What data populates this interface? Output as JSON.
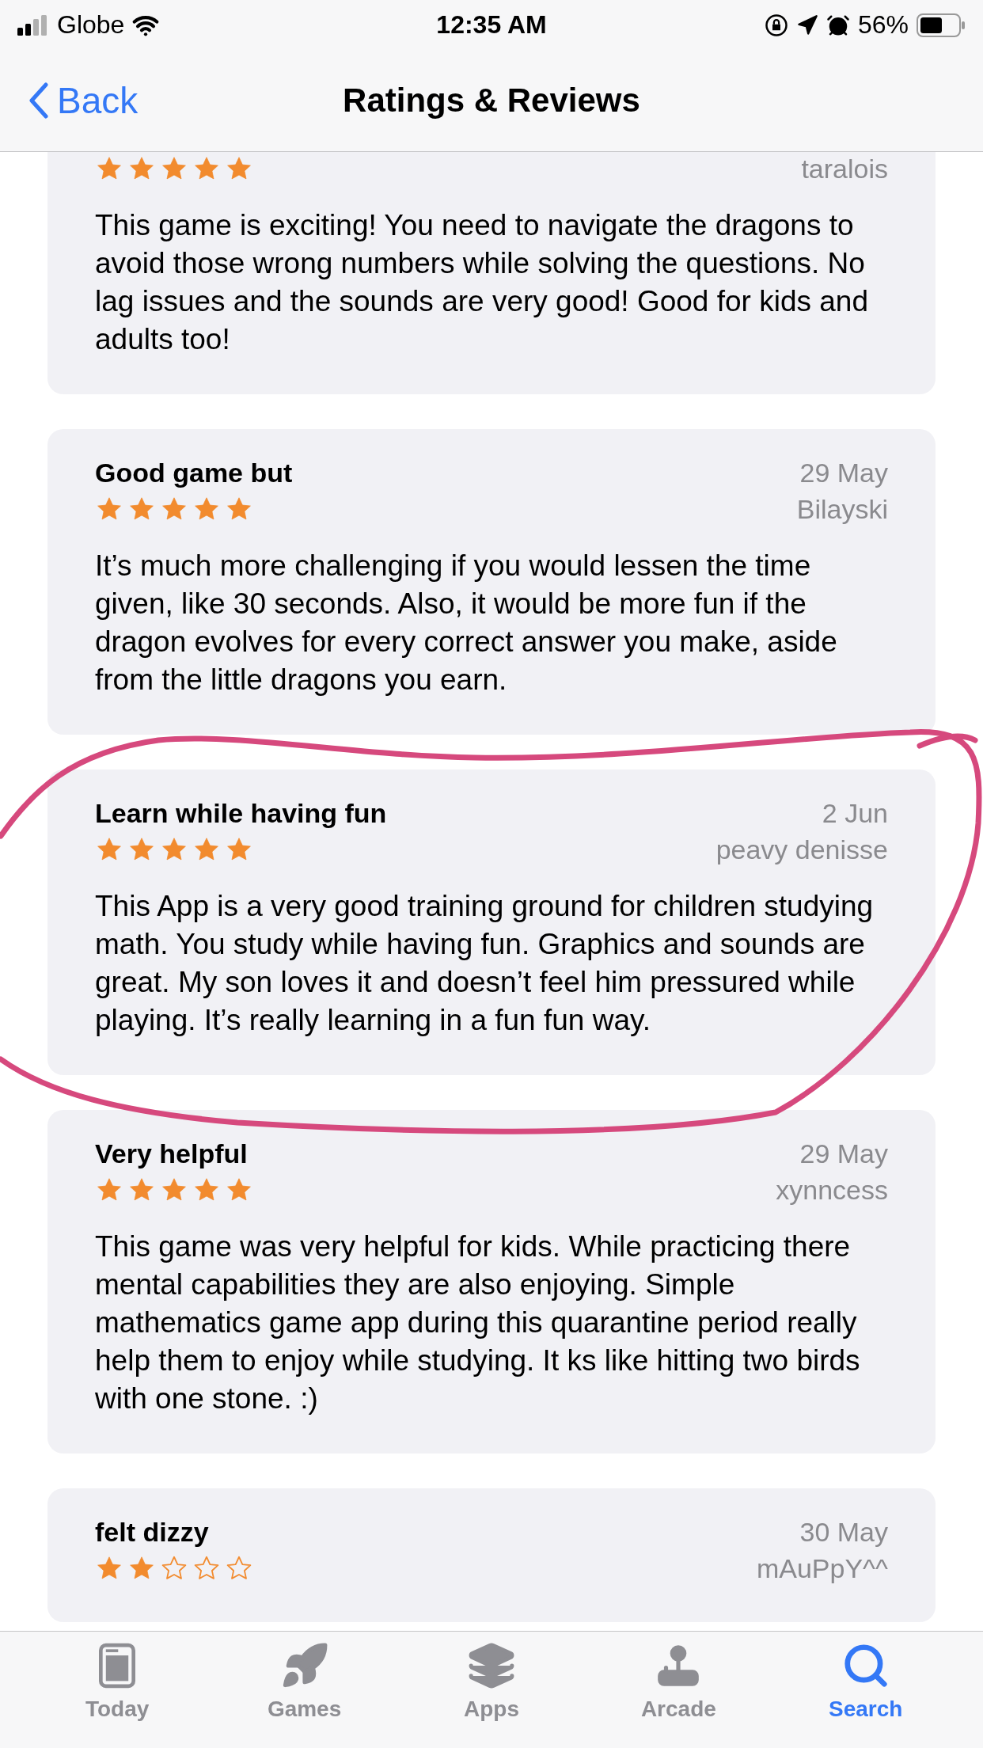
{
  "status_bar": {
    "carrier": "Globe",
    "time": "12:35 AM",
    "battery": "56%"
  },
  "nav": {
    "back": "Back",
    "title": "Ratings & Reviews"
  },
  "reviews": [
    {
      "stars": 5,
      "author": "taralois",
      "body": "This game is exciting! You need to navigate the dragons to avoid those wrong numbers while solving the questions. No lag issues and the sounds are very good! Good for kids and adults too!"
    },
    {
      "title": "Good game but",
      "date": "29 May",
      "stars": 5,
      "author": "Bilayski",
      "body": "It’s much more challenging if you would lessen the time given, like 30 seconds. Also, it would be more fun if the dragon evolves for every correct answer you make, aside from the little dragons you earn."
    },
    {
      "title": "Learn while having fun",
      "date": "2 Jun",
      "stars": 5,
      "author": "peavy denisse",
      "body": "This App is a very good training ground for children studying math. You study while having fun. Graphics and sounds are great. My son loves it and doesn’t feel him pressured while playing. It’s really learning in a fun fun way."
    },
    {
      "title": "Very helpful",
      "date": "29 May",
      "stars": 5,
      "author": "xynncess",
      "body": "This game was very helpful for kids. While practicing there mental capabilities they are also enjoying. Simple mathematics game app during this quarantine period really help them to enjoy while studying. It ks like hitting two birds with one stone. :)"
    },
    {
      "title": "felt dizzy",
      "date": "30 May",
      "stars": 2,
      "author": "mAuPpY^^"
    }
  ],
  "tab_bar": [
    {
      "label": "Today",
      "selected": false
    },
    {
      "label": "Games",
      "selected": false
    },
    {
      "label": "Apps",
      "selected": false
    },
    {
      "label": "Arcade",
      "selected": false
    },
    {
      "label": "Search",
      "selected": true
    }
  ]
}
